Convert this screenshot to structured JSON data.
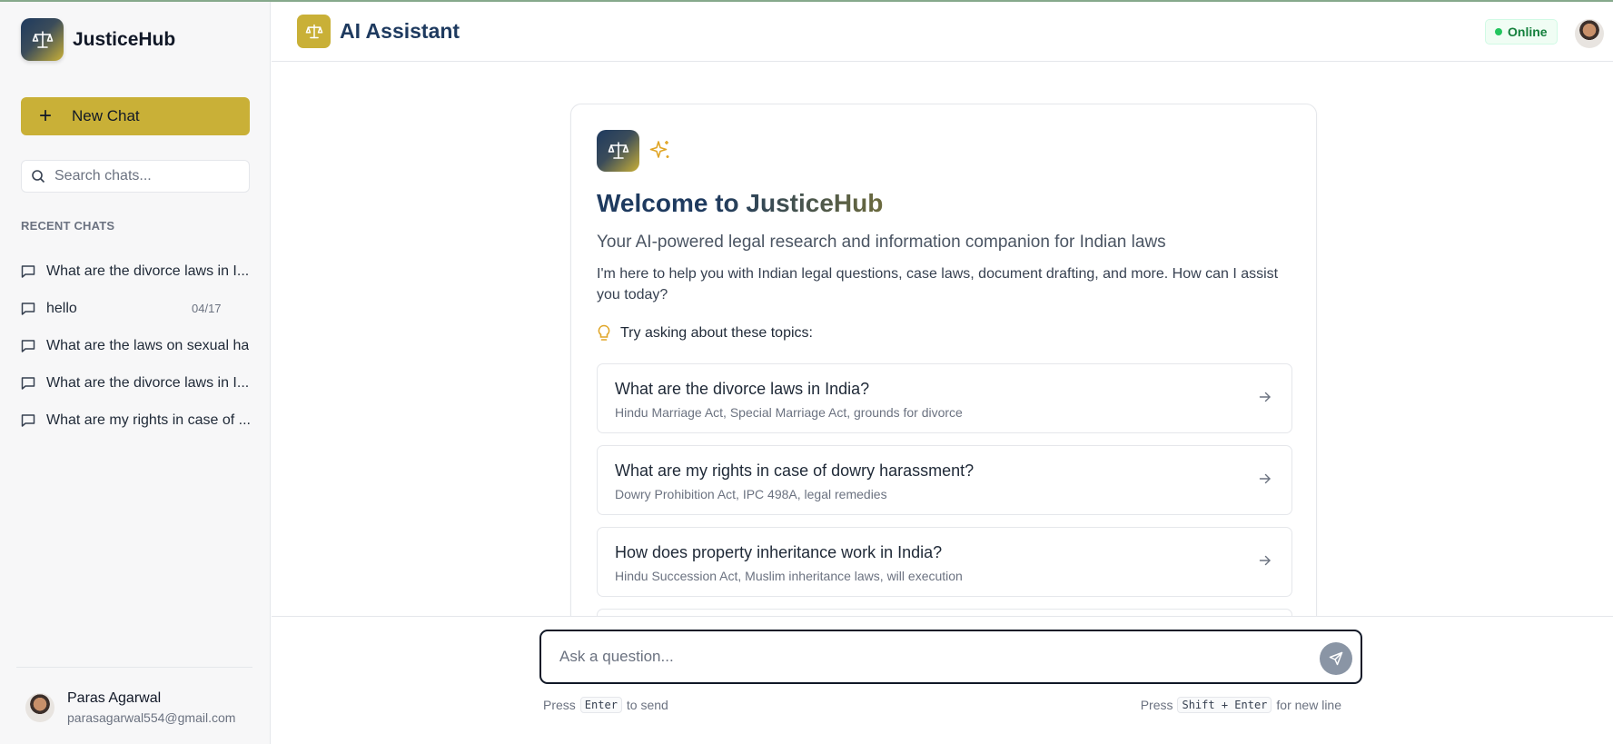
{
  "sidebar": {
    "brand": "JusticeHub",
    "new_chat_label": "New Chat",
    "search_placeholder": "Search chats...",
    "recent_title": "RECENT CHATS",
    "chats": [
      {
        "label": "What are the divorce laws in I...",
        "date": ""
      },
      {
        "label": "hello",
        "date": "04/17"
      },
      {
        "label": "What are the laws on sexual ha",
        "date": ""
      },
      {
        "label": "What are the divorce laws in I...",
        "date": ""
      },
      {
        "label": "What are my rights in case of ...",
        "date": ""
      }
    ],
    "user": {
      "name": "Paras Agarwal",
      "email": "parasagarwal554@gmail.com"
    }
  },
  "header": {
    "title": "AI Assistant",
    "status": "Online"
  },
  "welcome": {
    "title": "Welcome to JusticeHub",
    "subtitle": "Your AI-powered legal research and information companion for Indian laws",
    "description": "I'm here to help you with Indian legal questions, case laws, document drafting, and more. How can I assist you today?",
    "topics_label": "Try asking about these topics:",
    "topics": [
      {
        "title": "What are the divorce laws in India?",
        "desc": "Hindu Marriage Act, Special Marriage Act, grounds for divorce"
      },
      {
        "title": "What are my rights in case of dowry harassment?",
        "desc": "Dowry Prohibition Act, IPC 498A, legal remedies"
      },
      {
        "title": "How does property inheritance work in India?",
        "desc": "Hindu Succession Act, Muslim inheritance laws, will execution"
      }
    ]
  },
  "composer": {
    "placeholder": "Ask a question...",
    "hint_left_pre": "Press",
    "hint_left_key": "Enter",
    "hint_left_post": "to send",
    "hint_right_pre": "Press",
    "hint_right_key": "Shift + Enter",
    "hint_right_post": "for new line"
  },
  "colors": {
    "accent": "#c9b037",
    "navy": "#1e3a5f",
    "online": "#22c55e"
  }
}
